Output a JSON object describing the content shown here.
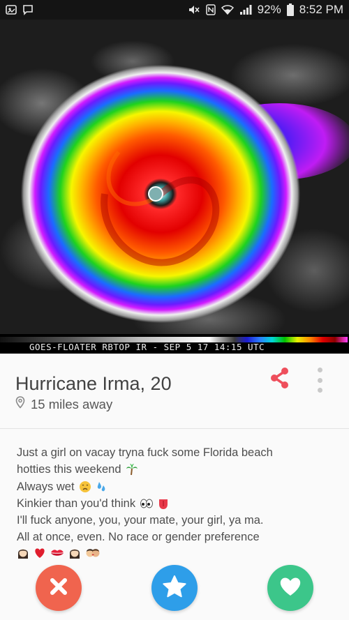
{
  "status_bar": {
    "battery_percent": "92%",
    "time": "8:52 PM",
    "icons": [
      "gallery-icon",
      "message-icon",
      "mute-icon",
      "nfc-icon",
      "wifi-icon",
      "signal-icon",
      "battery-icon"
    ]
  },
  "photo": {
    "description_icon": "hurricane-satellite-image",
    "caption": "GOES-FLOATER RBTOP IR - SEP 5 17 14:15 UTC"
  },
  "profile": {
    "name_age": "Hurricane Irma, 20",
    "distance": "15 miles away",
    "share_icon": "share-icon",
    "more_icon": "more-vertical-icon"
  },
  "bio": {
    "lines": [
      "Just a girl on vacay tryna fuck some Florida beach",
      "hotties this weekend",
      "Always wet",
      "Kinkier than you'd think",
      "I'll fuck anyone, you, your mate, your girl, ya ma.",
      "All at once, even. No race or gender preference"
    ],
    "emojis": {
      "line2": [
        "palm-tree-emoji"
      ],
      "line3": [
        "weary-face-emoji",
        "sweat-droplets-emoji"
      ],
      "line4": [
        "eyes-emoji",
        "tongue-emoji"
      ],
      "line7": [
        "woman-emoji",
        "heart-emoji",
        "kiss-mark-emoji",
        "woman-emoji",
        "couple-kiss-emoji"
      ]
    }
  },
  "actions": [
    {
      "name": "nope",
      "icon": "x-icon",
      "color": "#f0644e"
    },
    {
      "name": "super-like",
      "icon": "star-icon",
      "color": "#2e9ee9"
    },
    {
      "name": "like",
      "icon": "heart-icon",
      "color": "#3cc68a"
    }
  ],
  "colors": {
    "share_accent": "#ee4f5c",
    "status_bar_bg": "#141414"
  }
}
